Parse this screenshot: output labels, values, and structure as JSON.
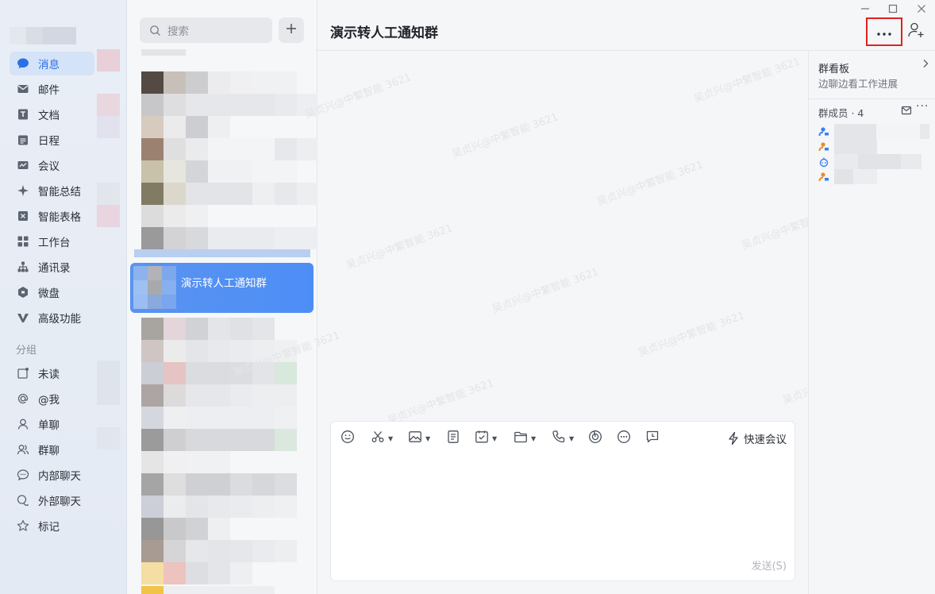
{
  "sidebar": {
    "items": [
      {
        "label": "消息",
        "icon": "message-icon",
        "active": true
      },
      {
        "label": "邮件",
        "icon": "mail-icon"
      },
      {
        "label": "文档",
        "icon": "doc-icon"
      },
      {
        "label": "日程",
        "icon": "calendar-icon"
      },
      {
        "label": "会议",
        "icon": "meeting-icon"
      },
      {
        "label": "智能总结",
        "icon": "sparkle-icon"
      },
      {
        "label": "智能表格",
        "icon": "smart-table-icon"
      },
      {
        "label": "工作台",
        "icon": "workbench-icon"
      },
      {
        "label": "通讯录",
        "icon": "contacts-icon"
      },
      {
        "label": "微盘",
        "icon": "drive-icon"
      },
      {
        "label": "高级功能",
        "icon": "premium-icon"
      }
    ],
    "group_label": "分组",
    "groups": [
      {
        "label": "未读",
        "icon": "unread-icon"
      },
      {
        "label": "@我",
        "icon": "at-icon"
      },
      {
        "label": "单聊",
        "icon": "single-chat-icon"
      },
      {
        "label": "群聊",
        "icon": "group-chat-icon"
      },
      {
        "label": "内部聊天",
        "icon": "internal-chat-icon"
      },
      {
        "label": "外部聊天",
        "icon": "external-chat-icon"
      },
      {
        "label": "标记",
        "icon": "star-icon"
      }
    ]
  },
  "chat_list": {
    "search_placeholder": "搜索",
    "selected_chat": "演示转人工通知群"
  },
  "chat": {
    "title": "演示转人工通知群",
    "watermark": "吴贞兴@中繁智能 3621",
    "quick_meeting_label": "快速会议",
    "send_label": "发送(S)"
  },
  "side_panel": {
    "board_title": "群看板",
    "board_subtitle": "边聊边看工作进展",
    "members_title": "群成员 · 4"
  },
  "colors": {
    "accent": "#2a6fe8",
    "selected_row": "#4d8ef6",
    "highlight_border": "#e02020"
  }
}
